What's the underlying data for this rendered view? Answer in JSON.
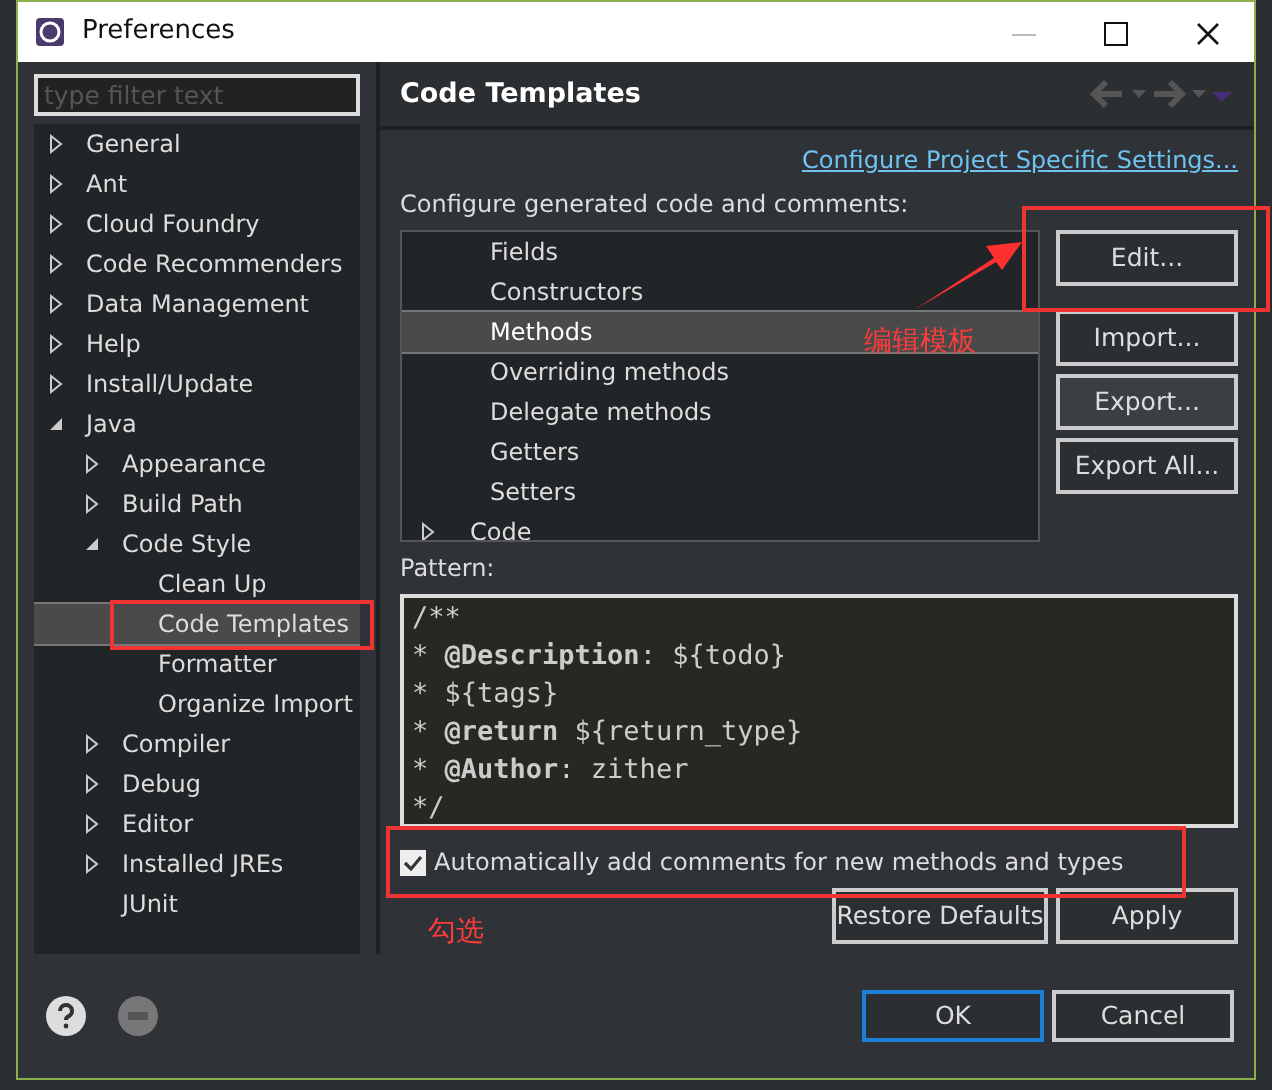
{
  "window": {
    "title": "Preferences"
  },
  "filter": {
    "placeholder": "type filter text"
  },
  "tree": [
    {
      "label": "General",
      "expanded": false,
      "selected": false
    },
    {
      "label": "Ant",
      "expanded": false,
      "selected": false
    },
    {
      "label": "Cloud Foundry",
      "expanded": false,
      "selected": false
    },
    {
      "label": "Code Recommenders",
      "expanded": false,
      "selected": false
    },
    {
      "label": "Data Management",
      "expanded": false,
      "selected": false
    },
    {
      "label": "Help",
      "expanded": false,
      "selected": false
    },
    {
      "label": "Install/Update",
      "expanded": false,
      "selected": false
    },
    {
      "label": "Java",
      "expanded": true,
      "selected": false,
      "children": [
        {
          "label": "Appearance",
          "expanded": false,
          "selected": false
        },
        {
          "label": "Build Path",
          "expanded": false,
          "selected": false
        },
        {
          "label": "Code Style",
          "expanded": true,
          "selected": false,
          "children": [
            {
              "label": "Clean Up",
              "selected": false
            },
            {
              "label": "Code Templates",
              "selected": true
            },
            {
              "label": "Formatter",
              "selected": false
            },
            {
              "label": "Organize Import",
              "selected": false
            }
          ]
        },
        {
          "label": "Compiler",
          "expanded": false,
          "selected": false
        },
        {
          "label": "Debug",
          "expanded": false,
          "selected": false
        },
        {
          "label": "Editor",
          "expanded": false,
          "selected": false
        },
        {
          "label": "Installed JREs",
          "expanded": false,
          "selected": false
        },
        {
          "label": "JUnit",
          "selected": false
        }
      ]
    }
  ],
  "page": {
    "title": "Code Templates",
    "link": "Configure Project Specific Settings...",
    "intro": "Configure generated code and comments:",
    "templates": [
      {
        "label": "Fields",
        "selected": false
      },
      {
        "label": "Constructors",
        "selected": false
      },
      {
        "label": "Methods",
        "selected": true
      },
      {
        "label": "Overriding methods",
        "selected": false
      },
      {
        "label": "Delegate methods",
        "selected": false
      },
      {
        "label": "Getters",
        "selected": false
      },
      {
        "label": "Setters",
        "selected": false
      },
      {
        "label": "Code",
        "expanded": false,
        "selected": false
      }
    ],
    "side_buttons": [
      "Edit...",
      "Import...",
      "Export...",
      "Export All..."
    ],
    "pattern_label": "Pattern:",
    "pattern": [
      "/**",
      "* **@Description**: ${todo}",
      "* ${tags}",
      "* **@return** ${return_type}",
      "* **@Author**: zither",
      "*/"
    ],
    "auto_comments": {
      "label": "Automatically add comments for new methods and types",
      "checked": true
    },
    "buttons": [
      "Restore Defaults",
      "Apply"
    ]
  },
  "footer_buttons": [
    "OK",
    "Cancel"
  ],
  "annotations": {
    "edit_note": "编辑模板",
    "check_note": "勾选"
  }
}
